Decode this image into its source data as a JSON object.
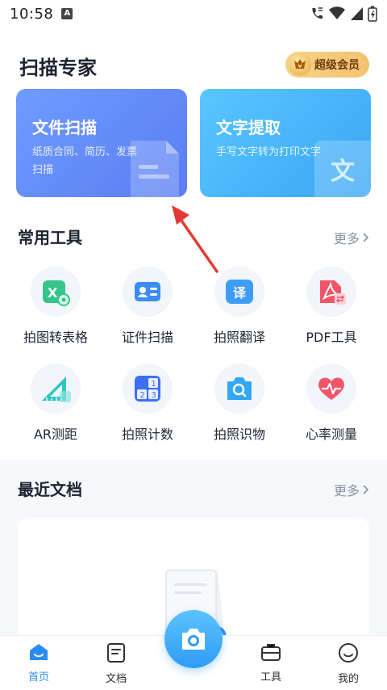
{
  "status_bar": {
    "time": "10:58",
    "sim_label": "A"
  },
  "header": {
    "title": "扫描专家",
    "vip_label": "超级会员"
  },
  "cards": {
    "scan": {
      "title": "文件扫描",
      "desc": "纸质合同、简历、发票扫描"
    },
    "ocr": {
      "title": "文字提取",
      "desc": "手写文字转为打印文字",
      "deco_char": "文"
    }
  },
  "tools_section": {
    "title": "常用工具",
    "more": "更多",
    "items": [
      {
        "label": "拍图转表格",
        "icon": "table-scan-icon"
      },
      {
        "label": "证件扫描",
        "icon": "id-card-icon"
      },
      {
        "label": "拍照翻译",
        "icon": "translate-icon",
        "glyph": "译"
      },
      {
        "label": "PDF工具",
        "icon": "pdf-icon"
      },
      {
        "label": "AR测距",
        "icon": "ruler-icon"
      },
      {
        "label": "拍照计数",
        "icon": "count-icon"
      },
      {
        "label": "拍照识物",
        "icon": "object-recognition-icon"
      },
      {
        "label": "心率测量",
        "icon": "heart-rate-icon"
      }
    ]
  },
  "recent_section": {
    "title": "最近文档",
    "more": "更多"
  },
  "bottom_nav": {
    "home": "首页",
    "docs": "文档",
    "tools": "工具",
    "mine": "我的"
  },
  "colors": {
    "accent": "#2b8cf7",
    "scan_card": "#6086f5",
    "ocr_card": "#45b3fa",
    "vip": "#f5c878",
    "arrow": "#e53935"
  }
}
